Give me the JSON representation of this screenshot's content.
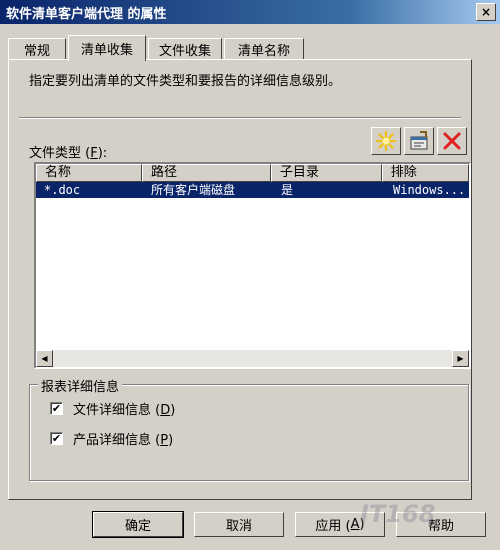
{
  "window": {
    "title": "软件清单客户端代理 的属性",
    "close_glyph": "×"
  },
  "tabs": [
    {
      "label": "常规"
    },
    {
      "label": "清单收集",
      "active": true
    },
    {
      "label": "文件收集"
    },
    {
      "label": "清单名称"
    }
  ],
  "panel": {
    "description": "指定要列出清单的文件类型和要报告的详细信息级别。",
    "filetype_label_prefix": "文件类型 (",
    "filetype_label_key": "F",
    "filetype_label_suffix": "):"
  },
  "toolbar": {
    "buttons": [
      {
        "icon": "new-star-icon"
      },
      {
        "icon": "properties-icon"
      },
      {
        "icon": "delete-x-icon"
      }
    ],
    "delete_color": "#e02020",
    "new_color": "#f0c010"
  },
  "listview": {
    "columns": [
      "名称",
      "路径",
      "子目录",
      "排除"
    ],
    "rows": [
      {
        "name": "*.doc",
        "path": "所有客户端磁盘",
        "subdir": "是",
        "exclude": "Windows..."
      }
    ],
    "selected_color": "#0a246a"
  },
  "details_group": {
    "title": "报表详细信息",
    "options": [
      {
        "prefix": "文件详细信息 (",
        "key": "D",
        "suffix": ")",
        "checked": true
      },
      {
        "prefix": "产品详细信息 (",
        "key": "P",
        "suffix": ")",
        "checked": true
      }
    ],
    "check_glyph": "✔"
  },
  "dialog_buttons": {
    "ok": "确定",
    "cancel": "取消",
    "apply_prefix": "应用 (",
    "apply_key": "A",
    "apply_suffix": ")",
    "help": "帮助"
  },
  "watermark": "IT168"
}
